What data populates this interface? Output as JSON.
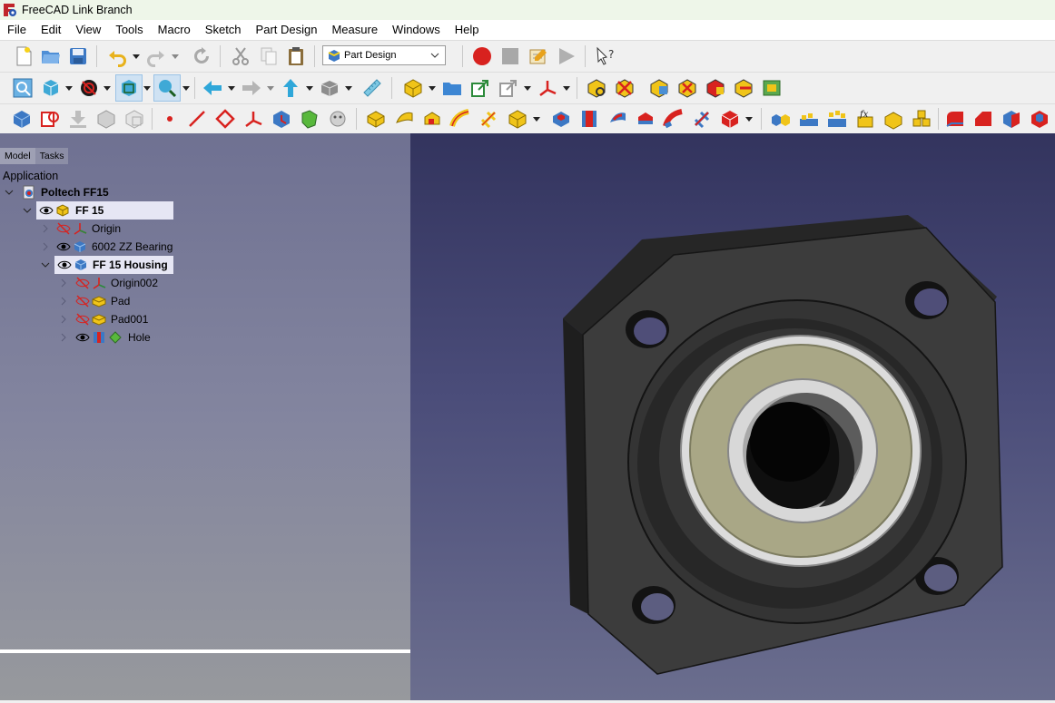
{
  "window": {
    "title": "FreeCAD Link Branch"
  },
  "menu": [
    "File",
    "Edit",
    "View",
    "Tools",
    "Macro",
    "Sketch",
    "Part Design",
    "Measure",
    "Windows",
    "Help"
  ],
  "workbench": {
    "selected": "Part Design"
  },
  "panel": {
    "tabs": [
      "Model",
      "Tasks"
    ],
    "section_title": "Application"
  },
  "tree": {
    "root": {
      "label": "Poltech FF15"
    },
    "body": {
      "label": "FF 15"
    },
    "origin": {
      "label": "Origin"
    },
    "bearing": {
      "label": "6002 ZZ Bearing"
    },
    "housing": {
      "label": "FF 15 Housing"
    },
    "origin002": {
      "label": "Origin002"
    },
    "pad": {
      "label": "Pad"
    },
    "pad001": {
      "label": "Pad001"
    },
    "hole": {
      "label": "Hole"
    }
  },
  "colors": {
    "record": "#d8221f",
    "accent": "#1c7ed6",
    "viewport_top": "#33345e",
    "viewport_bottom": "#6b6e8e",
    "part_body": "#3a3a3a",
    "bearing_shield": "#a9a786"
  }
}
